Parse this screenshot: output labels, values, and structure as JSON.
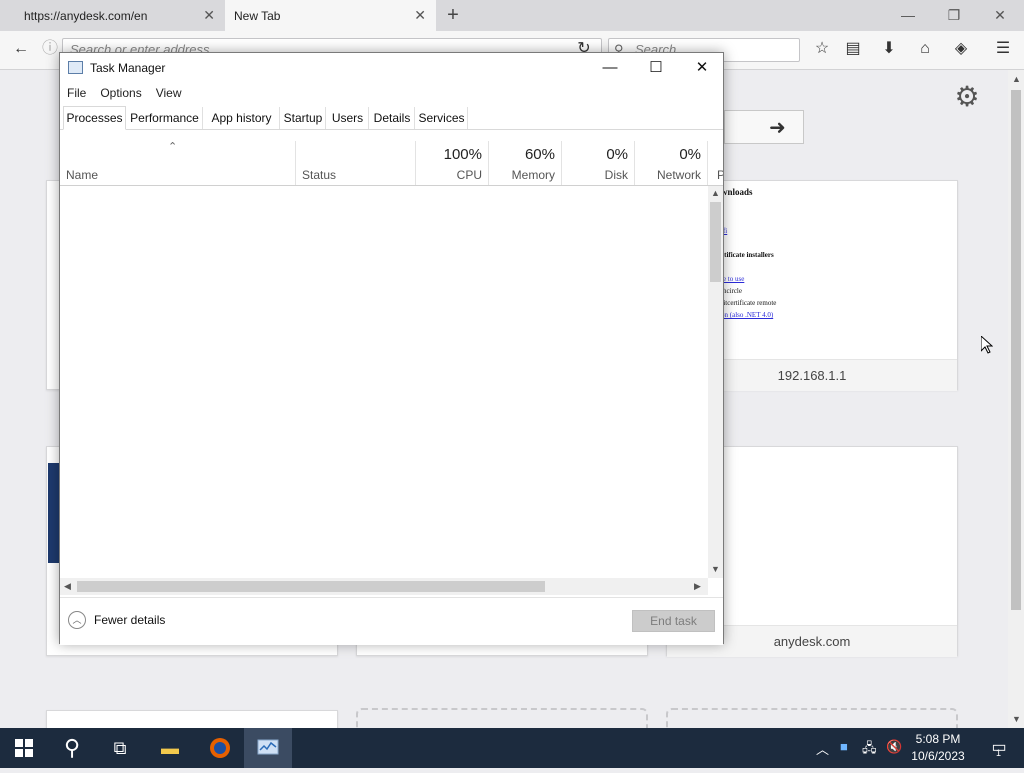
{
  "browser": {
    "tabs": [
      {
        "title": "https://anydesk.com/en",
        "active": false
      },
      {
        "title": "New Tab",
        "active": true
      }
    ],
    "urlbar_placeholder": "Search or enter address",
    "search_placeholder": "Search"
  },
  "new_tab_page": {
    "tiles": [
      {
        "label": "192.168.1.1"
      },
      {
        "label": "anydesk.com"
      }
    ],
    "thumbnail_text": [
      {
        "text": "wnloads",
        "bold": true
      },
      {
        "text": "ifi",
        "link": true
      },
      {
        "text": "rtificate installers",
        "bold": true
      },
      {
        "text": "le to use",
        "link": true
      },
      {
        "text": "thcircle",
        "link": false
      },
      {
        "text": "ritcertificate remote",
        "link": false
      },
      {
        "text": "on (also .NET 4.0)",
        "link": true
      }
    ]
  },
  "task_manager": {
    "title": "Task Manager",
    "menu": [
      "File",
      "Options",
      "View"
    ],
    "tabs": [
      "Processes",
      "Performance",
      "App history",
      "Startup",
      "Users",
      "Details",
      "Services"
    ],
    "selected_tab": "Processes",
    "columns": [
      {
        "label": "Name",
        "pct": ""
      },
      {
        "label": "Status",
        "pct": ""
      },
      {
        "label": "CPU",
        "pct": "100%"
      },
      {
        "label": "Memory",
        "pct": "60%"
      },
      {
        "label": "Disk",
        "pct": "0%"
      },
      {
        "label": "Network",
        "pct": "0%"
      },
      {
        "label": "P",
        "pct": ""
      }
    ],
    "fewer_details": "Fewer details",
    "end_task": "End task"
  },
  "taskbar": {
    "time": "5:08 PM",
    "date": "10/6/2023",
    "notification_count": "1"
  }
}
